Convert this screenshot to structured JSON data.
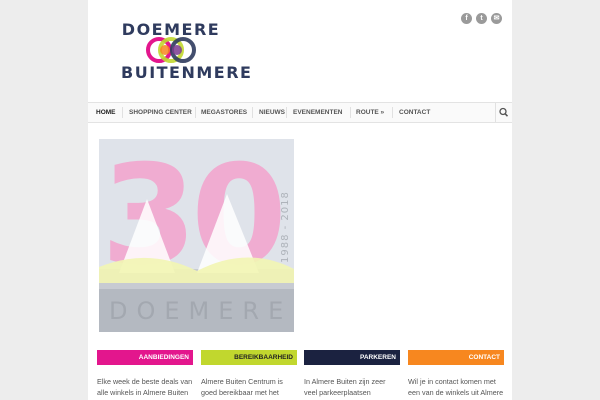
{
  "brand": {
    "line1": "DOEMERE",
    "line2": "BUITENMERE"
  },
  "social": [
    {
      "name": "facebook-icon",
      "glyph": "f"
    },
    {
      "name": "twitter-icon",
      "glyph": "t"
    },
    {
      "name": "email-icon",
      "glyph": "✉"
    }
  ],
  "nav": {
    "items": [
      "HOME",
      "SHOPPING CENTER",
      "MEGASTORES",
      "NIEUWS",
      "EVENEMENTEN",
      "ROUTE »",
      "CONTACT"
    ],
    "search_icon": "search-icon"
  },
  "hero": {
    "big_number": "30",
    "years": "1988 - 2018",
    "building_sign": "DOEMERE"
  },
  "tiles": [
    {
      "title": "AANBIEDINGEN",
      "color": "#e3168d",
      "text_color": "#ffffff",
      "text": "Elke week de beste deals van alle winkels in Almere Buiten Centrum"
    },
    {
      "title": "BEREIKBAARHEID",
      "color": "#c1d72e",
      "text_color": "#222222",
      "text": "Almere Buiten Centrum is goed bereikbaar met het openbaar vervoer"
    },
    {
      "title": "PARKEREN",
      "color": "#1b2240",
      "text_color": "#ffffff",
      "text": "In Almere Buiten zijn zeer veel parkeerplaatsen beschikbaar voor u"
    },
    {
      "title": "CONTACT",
      "color": "#f7871f",
      "text_color": "#ffffff",
      "text": "Wil je in contact komen met een van de winkels uit Almere Buiten"
    }
  ]
}
